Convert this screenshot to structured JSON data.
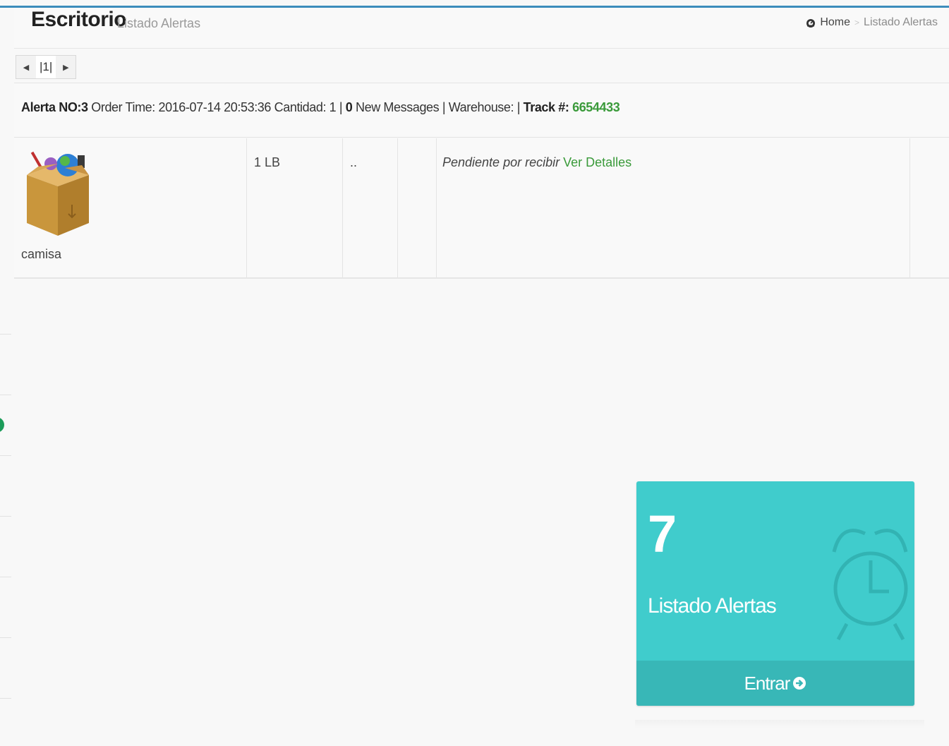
{
  "header": {
    "title": "Escritorio",
    "subtitle": "Listado Alertas",
    "breadcrumb": {
      "home": "Home",
      "current": "Listado Alertas",
      "home_icon": "dashboard-icon"
    }
  },
  "pager": {
    "prev_icon": "caret-left-icon",
    "page": "|1|",
    "next_icon": "caret-right-icon"
  },
  "alert": {
    "prefix": "Alerta NO:3",
    "order_time": "Order Time: 2016-07-14 20:53:36",
    "cantidad": "Cantidad: 1 |",
    "new_count": "0",
    "new_messages": "New Messages | Warehouse: |",
    "track_label": "Track #:",
    "track_number": "6654433"
  },
  "row": {
    "product_icon": "package-box-icon",
    "product_name": "camisa",
    "weight": "1 LB",
    "col3": "..",
    "col4": "",
    "status": "Pendiente por recibir",
    "details_link": "Ver Detalles",
    "col6": ""
  },
  "widget": {
    "count": "7",
    "label": "Listado Alertas",
    "button": "Entrar",
    "icon": "alarm-clock-icon",
    "button_icon": "arrow-circle-right-icon",
    "color": "#40cccc",
    "footer_color": "#38b7b7"
  },
  "colors": {
    "accent": "#3c8dbc",
    "link_green": "#3a9a3a"
  }
}
